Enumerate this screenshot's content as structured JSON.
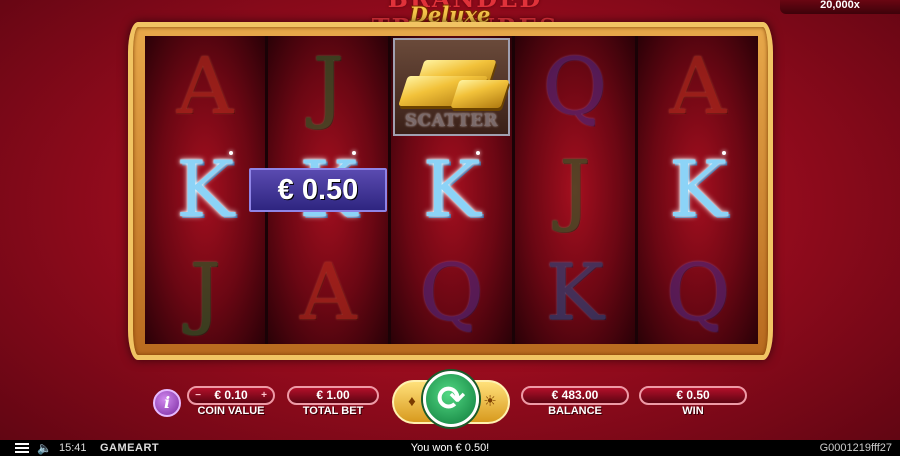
{
  "game": {
    "title": "BRANDED TREASURES",
    "subtitle": "Deluxe",
    "max_win": "20,000x"
  },
  "reels": [
    [
      "A",
      "K",
      "J"
    ],
    [
      "J",
      "K",
      "A"
    ],
    [
      "SCATTER",
      "K",
      "Q"
    ],
    [
      "Q",
      "J",
      "K"
    ],
    [
      "A",
      "K",
      "Q"
    ]
  ],
  "winning_row": 1,
  "win_banner": "€ 0.50",
  "controls": {
    "info": "i",
    "coin_value": {
      "value": "€ 0.10",
      "caption": "COIN VALUE"
    },
    "total_bet": {
      "value": "€ 1.00",
      "caption": "TOTAL BET"
    },
    "balance": {
      "value": "€ 483.00",
      "caption": "BALANCE"
    },
    "win": {
      "value": "€ 0.50",
      "caption": "WIN"
    },
    "step_minus": "−",
    "step_plus": "+",
    "spin_arrow": "⟳",
    "autoplay_icon": "autoplay-icon",
    "turbo_icon": "turbo-icon"
  },
  "status": {
    "time": "15:41",
    "brand": "GAMEART",
    "message": "You won € 0.50!",
    "session_id": "G0001219fff27"
  }
}
